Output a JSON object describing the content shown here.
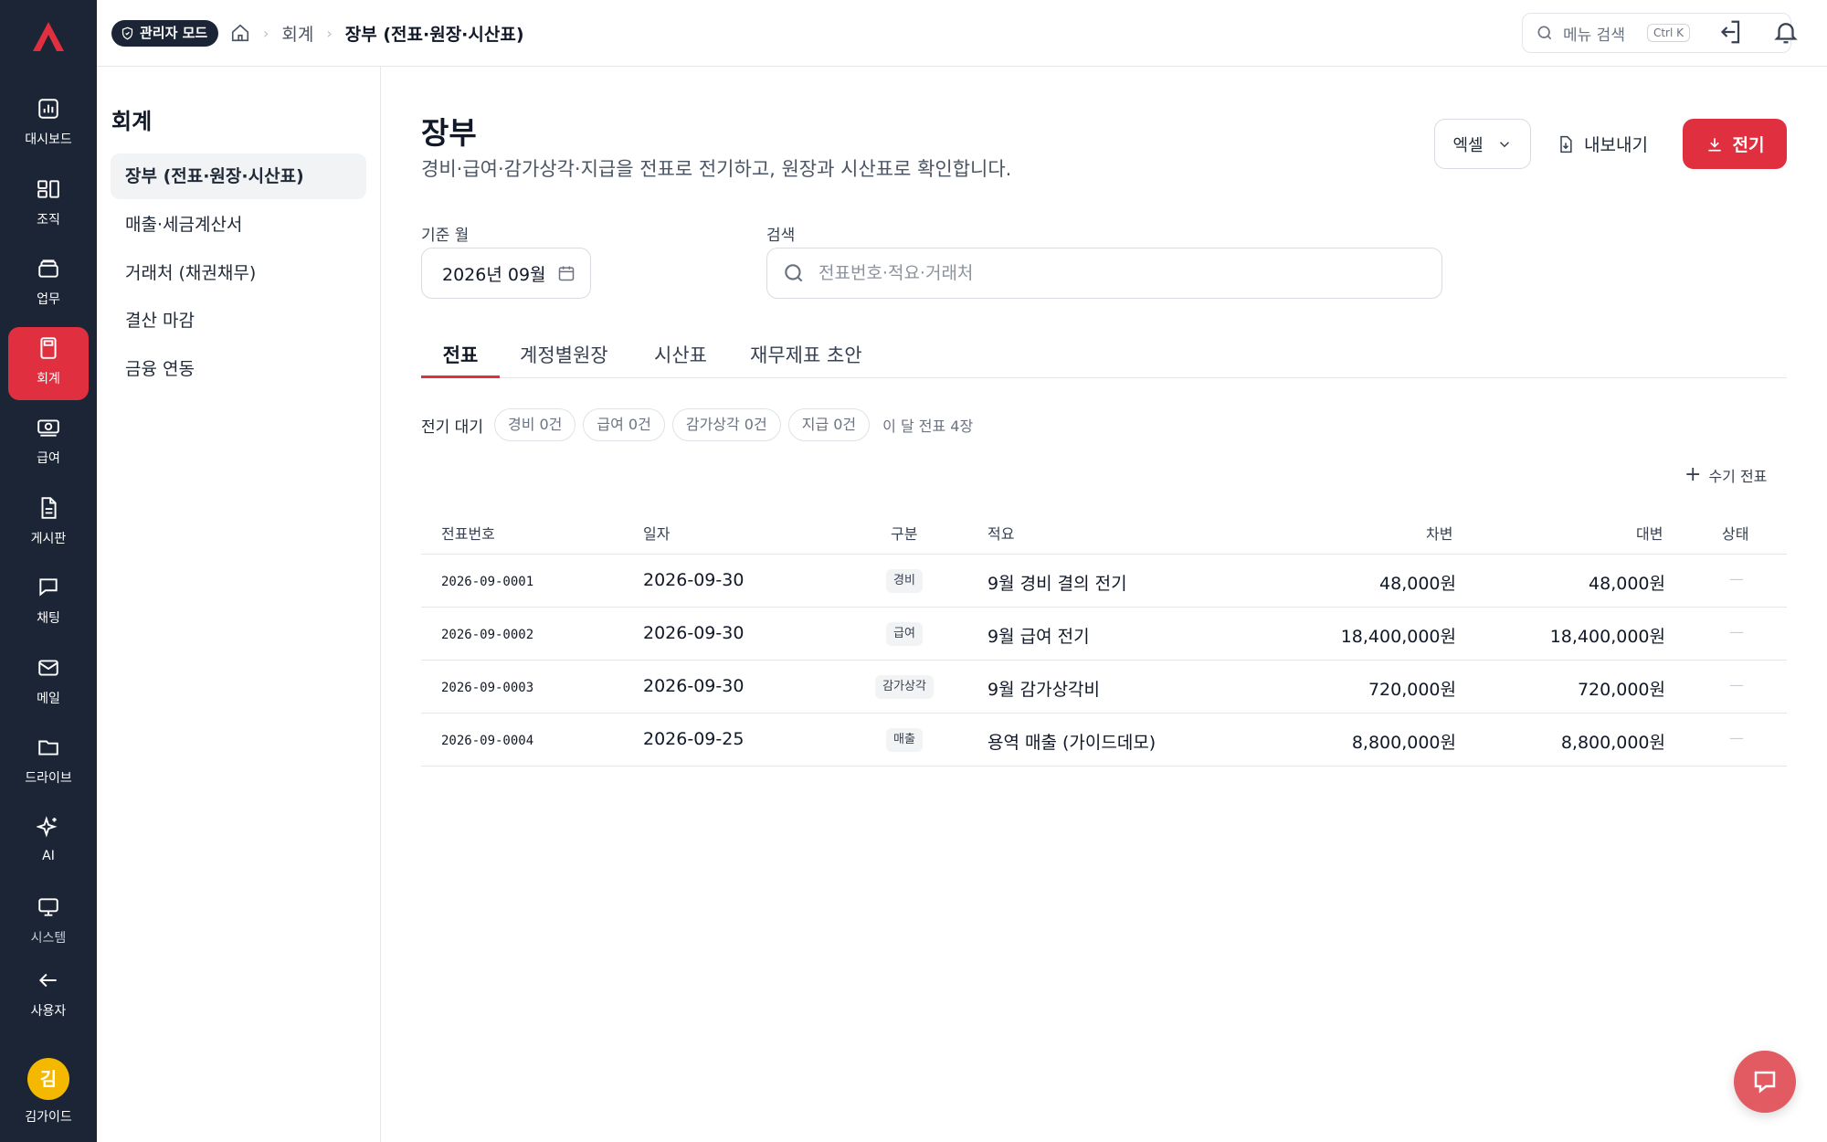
{
  "brand": {
    "accent": "#e0303f",
    "rail_bg": "#1b2536"
  },
  "rail": {
    "items": [
      {
        "label": "대시보드",
        "icon": "bar-chart-icon"
      },
      {
        "label": "조직",
        "icon": "org-chart-icon"
      },
      {
        "label": "업무",
        "icon": "tray-icon"
      },
      {
        "label": "회계",
        "icon": "calculator-icon",
        "active": true
      },
      {
        "label": "급여",
        "icon": "money-icon"
      },
      {
        "label": "게시판",
        "icon": "document-icon"
      },
      {
        "label": "채팅",
        "icon": "chat-icon"
      },
      {
        "label": "메일",
        "icon": "mail-icon"
      },
      {
        "label": "드라이브",
        "icon": "folder-icon"
      },
      {
        "label": "AI",
        "icon": "sparkle-icon"
      },
      {
        "label": "시스템",
        "icon": "monitor-icon"
      },
      {
        "label": "사용자",
        "icon": "arrow-left-icon"
      }
    ],
    "user": {
      "avatar_text": "김",
      "name": "김가이드"
    }
  },
  "header": {
    "admin_badge": "관리자 모드",
    "breadcrumb": {
      "section": "회계",
      "current": "장부 (전표·원장·시산표)"
    },
    "menu_search": {
      "placeholder": "메뉴 검색",
      "shortcut": "Ctrl K"
    }
  },
  "subnav": {
    "title": "회계",
    "items": [
      {
        "label": "장부 (전표·원장·시산표)",
        "active": true
      },
      {
        "label": "매출·세금계산서"
      },
      {
        "label": "거래처 (채권채무)"
      },
      {
        "label": "결산 마감"
      },
      {
        "label": "금융 연동"
      }
    ]
  },
  "page": {
    "title": "장부",
    "description": "경비·급여·감가상각·지급을 전표로 전기하고, 원장과 시산표로 확인합니다.",
    "actions": {
      "excel": "엑셀",
      "export": "내보내기",
      "post": "전기"
    },
    "filters": {
      "month_label": "기준 월",
      "month_value": "2026년 09월",
      "search_label": "검색",
      "search_placeholder": "전표번호·적요·거래처",
      "search_value": ""
    },
    "tabs": [
      "전표",
      "계정별원장",
      "시산표",
      "재무제표 초안"
    ],
    "pending": {
      "label": "전기 대기",
      "chips": [
        "경비 0건",
        "급여 0건",
        "감가상각 0건",
        "지급 0건"
      ],
      "count": "이 달 전표 4장"
    },
    "manual_entry": "수기 전표",
    "table": {
      "headers": [
        "전표번호",
        "일자",
        "구분",
        "적요",
        "차변",
        "대변",
        "상태"
      ],
      "rows": [
        {
          "no": "2026-09-0001",
          "date": "2026-09-30",
          "type": "경비",
          "desc": "9월 경비 결의 전기",
          "debit": "48,000원",
          "credit": "48,000원",
          "status": "—"
        },
        {
          "no": "2026-09-0002",
          "date": "2026-09-30",
          "type": "급여",
          "desc": "9월 급여 전기",
          "debit": "18,400,000원",
          "credit": "18,400,000원",
          "status": "—"
        },
        {
          "no": "2026-09-0003",
          "date": "2026-09-30",
          "type": "감가상각",
          "desc": "9월 감가상각비",
          "debit": "720,000원",
          "credit": "720,000원",
          "status": "—"
        },
        {
          "no": "2026-09-0004",
          "date": "2026-09-25",
          "type": "매출",
          "desc": "용역 매출 (가이드데모)",
          "debit": "8,800,000원",
          "credit": "8,800,000원",
          "status": "—"
        }
      ]
    }
  }
}
